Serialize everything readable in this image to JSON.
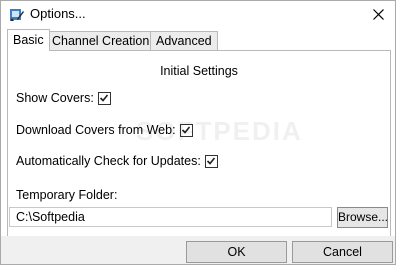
{
  "window": {
    "title": "Options...",
    "close_label": "close window"
  },
  "tabs": [
    {
      "label": "Basic",
      "active": true
    },
    {
      "label": "Channel Creation",
      "active": false
    },
    {
      "label": "Advanced",
      "active": false
    }
  ],
  "basic": {
    "section_title": "Initial Settings",
    "show_covers": {
      "label": "Show Covers:",
      "checked": true
    },
    "download_covers": {
      "label": "Download Covers from Web:",
      "checked": true
    },
    "check_updates": {
      "label": "Automatically Check for Updates:",
      "checked": true
    },
    "temp_folder_label": "Temporary Folder:",
    "temp_folder_value": "C:\\Softpedia",
    "browse_label": "Browse..."
  },
  "footer": {
    "ok_label": "OK",
    "cancel_label": "Cancel"
  },
  "watermark": "SOFTPEDIA"
}
